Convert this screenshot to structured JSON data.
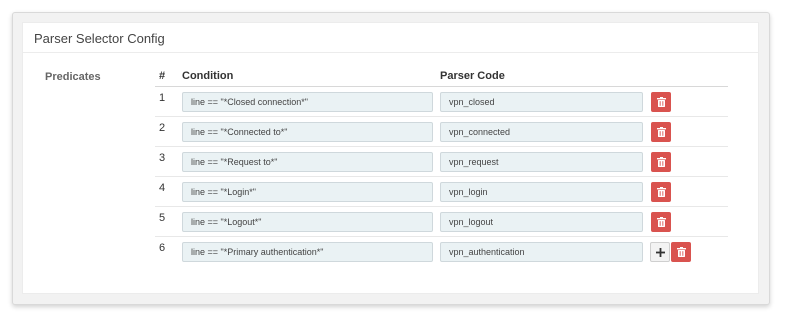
{
  "card": {
    "title": "Parser Selector Config",
    "section_label": "Predicates"
  },
  "table": {
    "headers": {
      "num": "#",
      "condition": "Condition",
      "parser_code": "Parser Code"
    },
    "rows": [
      {
        "num": "1",
        "condition": "line == \"*Closed connection*\"",
        "parser_code": "vpn_closed"
      },
      {
        "num": "2",
        "condition": "line == \"*Connected to*\"",
        "parser_code": "vpn_connected"
      },
      {
        "num": "3",
        "condition": "line == \"*Request to*\"",
        "parser_code": "vpn_request"
      },
      {
        "num": "4",
        "condition": "line == \"*Login*\"",
        "parser_code": "vpn_login"
      },
      {
        "num": "5",
        "condition": "line == \"*Logout*\"",
        "parser_code": "vpn_logout"
      },
      {
        "num": "6",
        "condition": "line == \"*Primary authentication*\"",
        "parser_code": "vpn_authentication"
      }
    ]
  },
  "colors": {
    "delete_button": "#d9534f",
    "input_background": "#eaf2f4"
  },
  "icons": {
    "delete": "trash-icon",
    "add": "plus-icon"
  }
}
